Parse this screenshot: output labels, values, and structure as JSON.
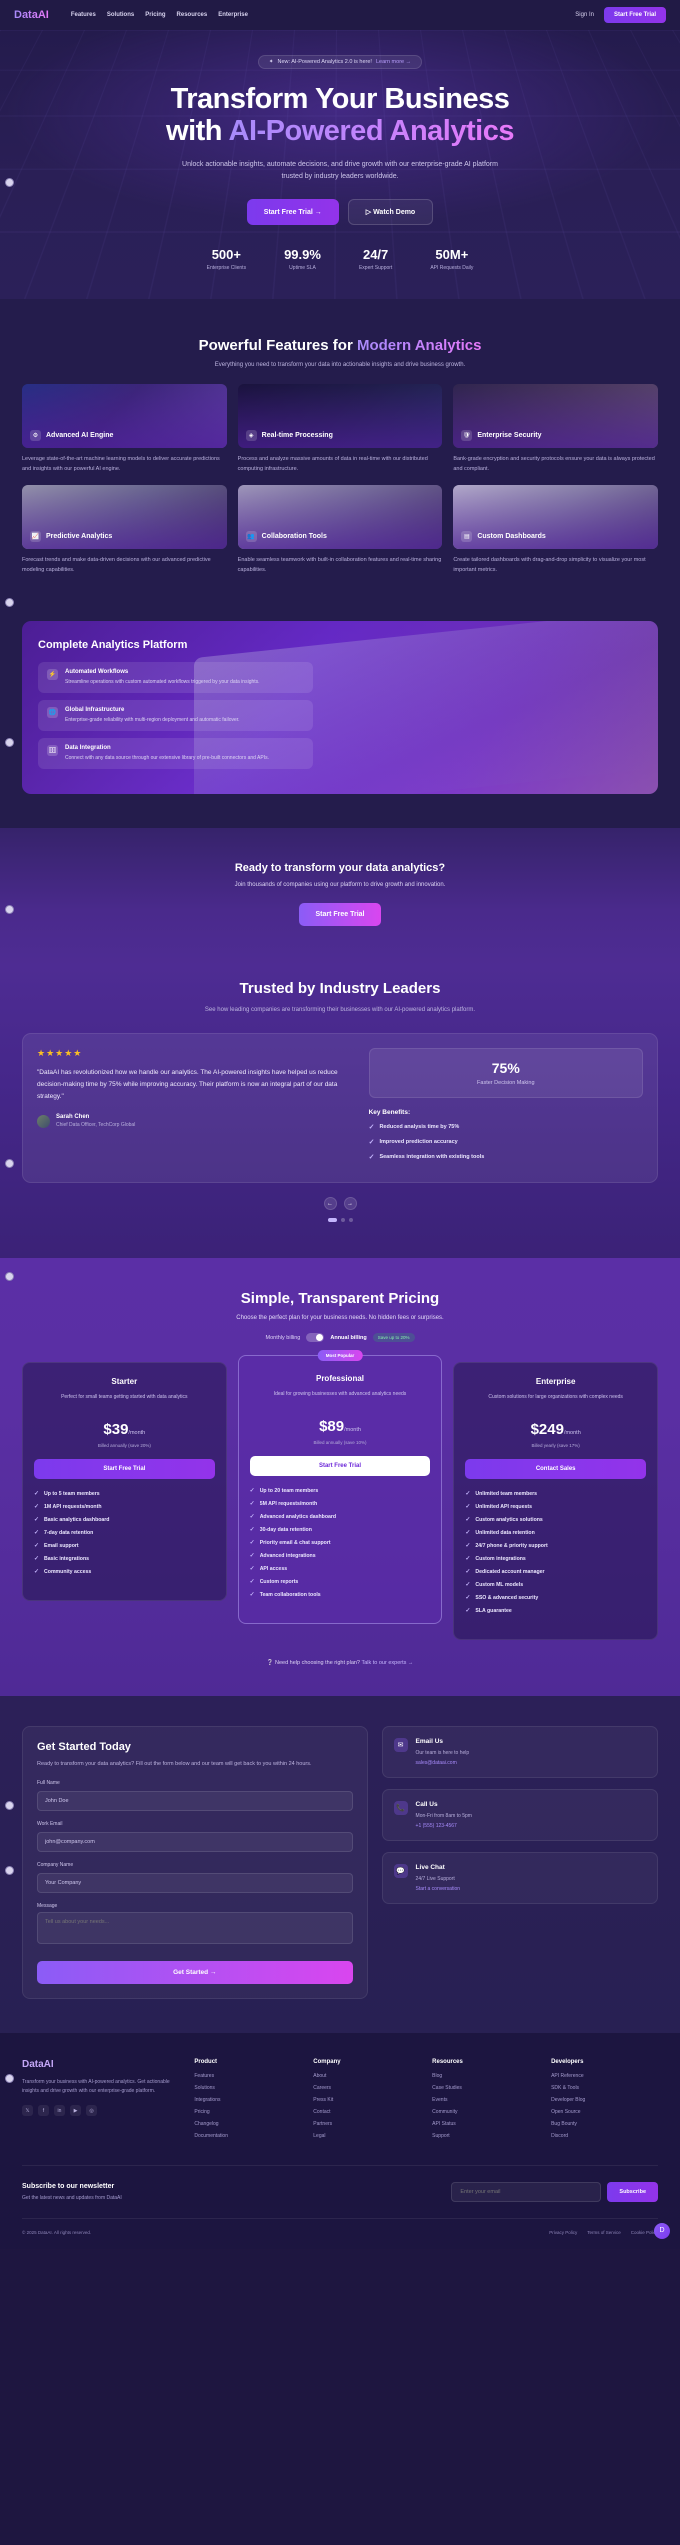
{
  "nav": {
    "logo": "DataAI",
    "links": [
      "Features",
      "Solutions",
      "Pricing",
      "Resources",
      "Enterprise"
    ],
    "signin": "Sign In",
    "cta": "Start Free Trial"
  },
  "hero": {
    "badge_text": "New: AI-Powered Analytics 2.0 is here!",
    "badge_link": "Learn more →",
    "title_line1": "Transform Your Business",
    "title_line2_plain": "with ",
    "title_line2_grad": "AI-Powered Analytics",
    "subtitle": "Unlock actionable insights, automate decisions, and drive growth with our enterprise-grade AI platform trusted by industry leaders worldwide.",
    "btn_primary": "Start Free Trial  →",
    "btn_secondary": "▷  Watch Demo",
    "stats": [
      {
        "value": "500+",
        "label": "Enterprise Clients"
      },
      {
        "value": "99.9%",
        "label": "Uptime SLA"
      },
      {
        "value": "24/7",
        "label": "Expert Support"
      },
      {
        "value": "50M+",
        "label": "API Requests Daily"
      }
    ]
  },
  "features": {
    "title_plain": "Powerful Features for ",
    "title_grad": "Modern Analytics",
    "subtitle": "Everything you need to transform your data into actionable insights and drive business growth.",
    "cards": [
      {
        "icon": "⚙",
        "title": "Advanced AI Engine",
        "desc": "Leverage state-of-the-art machine learning models to deliver accurate predictions and insights with our powerful AI engine."
      },
      {
        "icon": "◈",
        "title": "Real-time Processing",
        "desc": "Process and analyze massive amounts of data in real-time with our distributed computing infrastructure."
      },
      {
        "icon": "🛡",
        "title": "Enterprise Security",
        "desc": "Bank-grade encryption and security protocols ensure your data is always protected and compliant."
      },
      {
        "icon": "📈",
        "title": "Predictive Analytics",
        "desc": "Forecast trends and make data-driven decisions with our advanced predictive modeling capabilities."
      },
      {
        "icon": "👥",
        "title": "Collaboration Tools",
        "desc": "Enable seamless teamwork with built-in collaboration features and real-time sharing capabilities."
      },
      {
        "icon": "▤",
        "title": "Custom Dashboards",
        "desc": "Create tailored dashboards with drag-and-drop simplicity to visualize your most important metrics."
      }
    ]
  },
  "platform": {
    "title": "Complete Analytics Platform",
    "rows": [
      {
        "icon": "⚡",
        "title": "Automated Workflows",
        "desc": "Streamline operations with custom automated workflows triggered by your data insights."
      },
      {
        "icon": "🌐",
        "title": "Global Infrastructure",
        "desc": "Enterprise-grade reliability with multi-region deployment and automatic failover."
      },
      {
        "icon": "🗄",
        "title": "Data Integration",
        "desc": "Connect with any data source through our extensive library of pre-built connectors and APIs."
      }
    ]
  },
  "cta": {
    "title": "Ready to transform your data analytics?",
    "subtitle": "Join thousands of companies using our platform to drive growth and innovation.",
    "button": "Start Free Trial"
  },
  "testimonials": {
    "title": "Trusted by Industry Leaders",
    "subtitle": "See how leading companies are transforming their businesses with our AI-powered analytics platform.",
    "stars": "★★★★★",
    "quote": "\"DataAI has revolutionized how we handle our analytics. The AI-powered insights have helped us reduce decision-making time by 75% while improving accuracy. Their platform is now an integral part of our data strategy.\"",
    "author_name": "Sarah Chen",
    "author_role": "Chief Data Officer, TechCorp Global",
    "metric_value": "75%",
    "metric_label": "Faster Decision Making",
    "benefits_title": "Key Benefits:",
    "benefits": [
      "Reduced analysis time by 75%",
      "Improved prediction accuracy",
      "Seamless integration with existing tools"
    ],
    "prev": "←",
    "next": "→"
  },
  "pricing": {
    "title": "Simple, Transparent Pricing",
    "subtitle": "Choose the perfect plan for your business needs. No hidden fees or surprises.",
    "toggle_monthly": "Monthly billing",
    "toggle_annual": "Annual billing",
    "toggle_save": "Save up to 20%",
    "popular_badge": "Most Popular",
    "plans": [
      {
        "name": "Starter",
        "desc": "Perfect for small teams getting started with data analytics",
        "amount": "$39",
        "period": "/month",
        "billing": "Billed annually (save 20%)",
        "button": "Start Free Trial",
        "features": [
          "Up to 5 team members",
          "1M API requests/month",
          "Basic analytics dashboard",
          "7-day data retention",
          "Email support",
          "Basic integrations",
          "Community access"
        ]
      },
      {
        "name": "Professional",
        "desc": "Ideal for growing businesses with advanced analytics needs",
        "amount": "$89",
        "period": "/month",
        "billing": "Billed annually (save 10%)",
        "button": "Start Free Trial",
        "features": [
          "Up to 20 team members",
          "5M API requests/month",
          "Advanced analytics dashboard",
          "30-day data retention",
          "Priority email & chat support",
          "Advanced integrations",
          "API access",
          "Custom reports",
          "Team collaboration tools"
        ]
      },
      {
        "name": "Enterprise",
        "desc": "Custom solutions for large organizations with complex needs",
        "amount": "$249",
        "period": "/month",
        "billing": "Billed yearly (save 17%)",
        "button": "Contact Sales",
        "features": [
          "Unlimited team members",
          "Unlimited API requests",
          "Custom analytics solutions",
          "Unlimited data retention",
          "24/7 phone & priority support",
          "Custom integrations",
          "Dedicated account manager",
          "Custom ML models",
          "SSO & advanced security",
          "SLA guarantee"
        ]
      }
    ],
    "help_text": "Need help choosing the right plan?",
    "help_link": "Talk to our experts →"
  },
  "contact": {
    "title": "Get Started Today",
    "subtitle": "Ready to transform your data analytics? Fill out the form below and our team will get back to you within 24 hours.",
    "fields": [
      {
        "label": "Full Name",
        "value": "John Doe"
      },
      {
        "label": "Work Email",
        "value": "john@company.com"
      },
      {
        "label": "Company Name",
        "value": "Your Company"
      }
    ],
    "message_label": "Message",
    "message_placeholder": "Tell us about your needs...",
    "submit": "Get Started  →",
    "cards": [
      {
        "icon": "✉",
        "title": "Email Us",
        "text": "Our team is here to help",
        "link": "sales@dataai.com"
      },
      {
        "icon": "📞",
        "title": "Call Us",
        "text": "Mon-Fri from 8am to 5pm",
        "link": "+1 (555) 123-4567"
      },
      {
        "icon": "💬",
        "title": "Live Chat",
        "text": "24/7 Live Support",
        "link": "Start a conversation"
      }
    ]
  },
  "footer": {
    "logo": "DataAI",
    "about": "Transform your business with AI-powered analytics. Get actionable insights and drive growth with our enterprise-grade platform.",
    "socials": [
      "𝕏",
      "f",
      "in",
      "▶",
      "◎"
    ],
    "columns": [
      {
        "heading": "Product",
        "links": [
          "Features",
          "Solutions",
          "Integrations",
          "Pricing",
          "Changelog",
          "Documentation"
        ]
      },
      {
        "heading": "Company",
        "links": [
          "About",
          "Careers",
          "Press Kit",
          "Contact",
          "Partners",
          "Legal"
        ]
      },
      {
        "heading": "Resources",
        "links": [
          "Blog",
          "Case Studies",
          "Events",
          "Community",
          "API Status",
          "Support"
        ]
      },
      {
        "heading": "Developers",
        "links": [
          "API Reference",
          "SDK & Tools",
          "Developer Blog",
          "Open Source",
          "Bug Bounty",
          "Discord"
        ]
      }
    ],
    "newsletter_title": "Subscribe to our newsletter",
    "newsletter_sub": "Get the latest news and updates from DataAI",
    "newsletter_placeholder": "Enter your email",
    "newsletter_button": "Subscribe",
    "copyright": "© 2025 DataAI. All rights reserved.",
    "legal": [
      "Privacy Policy",
      "Terms of Service",
      "Cookie Policy"
    ]
  },
  "fab": "D"
}
